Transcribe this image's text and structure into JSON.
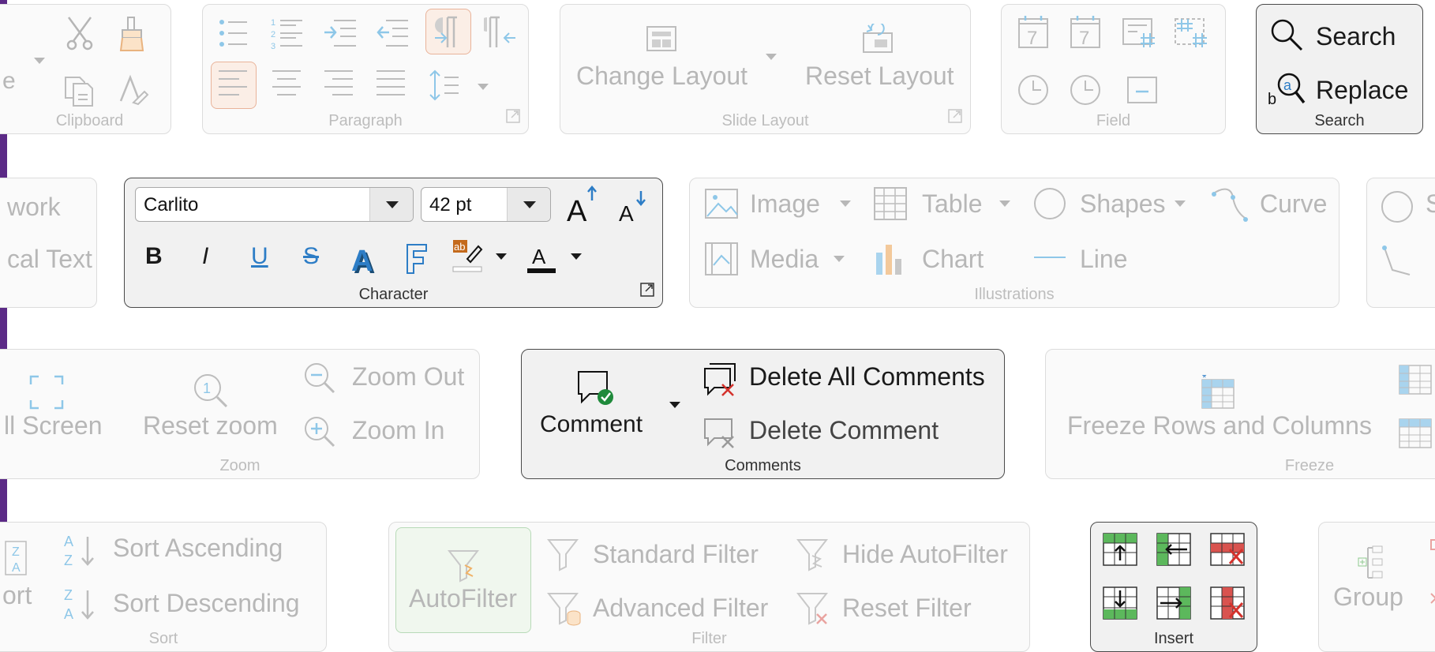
{
  "stripe_color": "#5b2a86",
  "clipboard": {
    "label": "Clipboard",
    "partial": "e"
  },
  "paragraph": {
    "label": "Paragraph"
  },
  "slide_layout": {
    "label": "Slide Layout",
    "change": "Change Layout",
    "reset": "Reset Layout"
  },
  "field": {
    "label": "Field"
  },
  "search": {
    "label": "Search",
    "search": "Search",
    "replace": "Replace"
  },
  "fontwork": {
    "partial1": "work",
    "partial2": "cal Text"
  },
  "character": {
    "label": "Character",
    "font": "Carlito",
    "size": "42 pt",
    "bold": "B",
    "italic": "I",
    "underline": "U",
    "strike": "S"
  },
  "illustrations": {
    "label": "Illustrations",
    "image": "Image",
    "table": "Table",
    "shapes": "Shapes",
    "curve": "Curve",
    "media": "Media",
    "chart": "Chart",
    "line": "Line",
    "partial": "S"
  },
  "zoom": {
    "label": "Zoom",
    "full": "ll Screen",
    "reset": "Reset zoom",
    "out": "Zoom Out",
    "in": "Zoom In"
  },
  "comments": {
    "label": "Comments",
    "comment": "Comment",
    "delete_all": "Delete All Comments",
    "delete": "Delete Comment"
  },
  "freeze": {
    "label": "Freeze",
    "text": "Freeze Rows and Columns"
  },
  "sort": {
    "label": "Sort",
    "partial": "ort",
    "asc": "Sort Ascending",
    "desc": "Sort Descending"
  },
  "filter": {
    "label": "Filter",
    "auto": "AutoFilter",
    "standard": "Standard Filter",
    "hide": "Hide AutoFilter",
    "advanced": "Advanced Filter",
    "reset": "Reset Filter"
  },
  "insert": {
    "label": "Insert"
  },
  "group": {
    "label": "Group"
  }
}
